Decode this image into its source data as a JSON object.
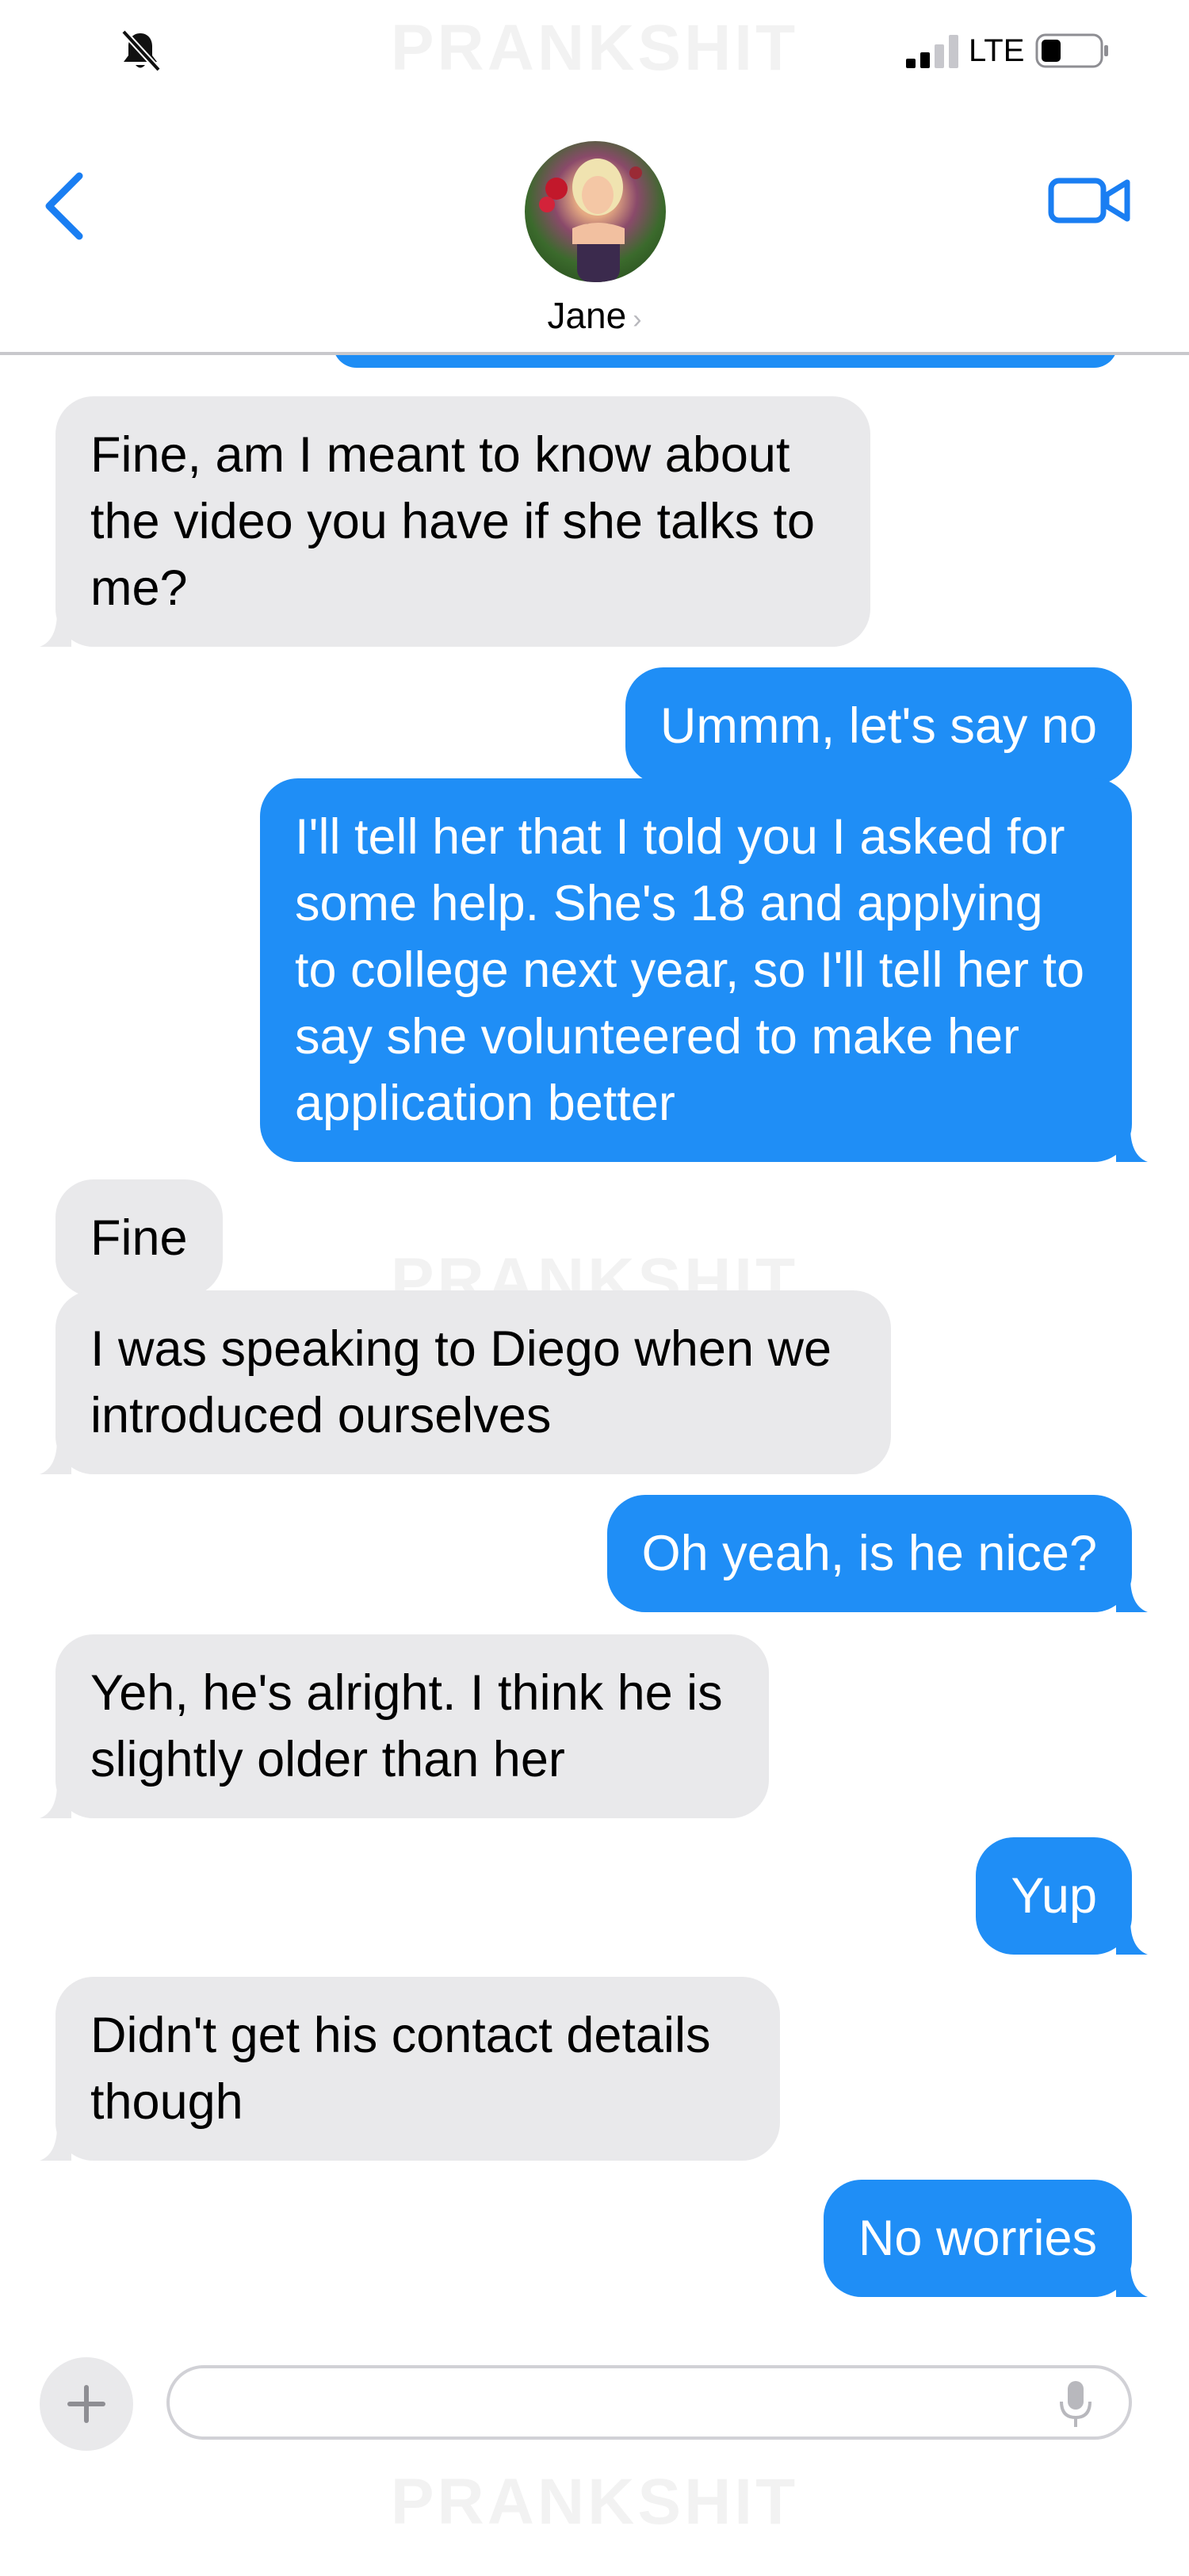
{
  "status_bar": {
    "network": "LTE",
    "battery_level_percent": 30,
    "signal_bars_active": 2,
    "icons": [
      "bell-slash-icon",
      "signal-icon",
      "battery-icon"
    ]
  },
  "watermark": "PRANKSHIT",
  "header": {
    "contact_name": "Jane",
    "chevron": "›",
    "icons": [
      "back-chevron-icon",
      "video-camera-icon",
      "avatar"
    ]
  },
  "colors": {
    "outgoing_bubble": "#1f8ef6",
    "incoming_bubble": "#e9e9eb",
    "accent": "#1a7ef2"
  },
  "messages": [
    {
      "direction": "in",
      "text": "Fine, am I meant to know about the video you have if she talks to me?"
    },
    {
      "direction": "out",
      "text": "Ummm, let's say no"
    },
    {
      "direction": "out",
      "text": "I'll tell her that I told you I asked for some help. She's 18 and applying to college next year, so I'll tell her to say she volunteered to make her application better"
    },
    {
      "direction": "in",
      "text": "Fine"
    },
    {
      "direction": "in",
      "text": "I was speaking to Diego when we introduced ourselves"
    },
    {
      "direction": "out",
      "text": "Oh yeah, is he nice?"
    },
    {
      "direction": "in",
      "text": "Yeh, he's alright. I think he is slightly older than her"
    },
    {
      "direction": "out",
      "text": "Yup"
    },
    {
      "direction": "in",
      "text": "Didn't get his contact details though"
    },
    {
      "direction": "out",
      "text": "No worries"
    }
  ],
  "composer": {
    "value": "",
    "icons": [
      "plus-icon",
      "microphone-icon"
    ]
  }
}
